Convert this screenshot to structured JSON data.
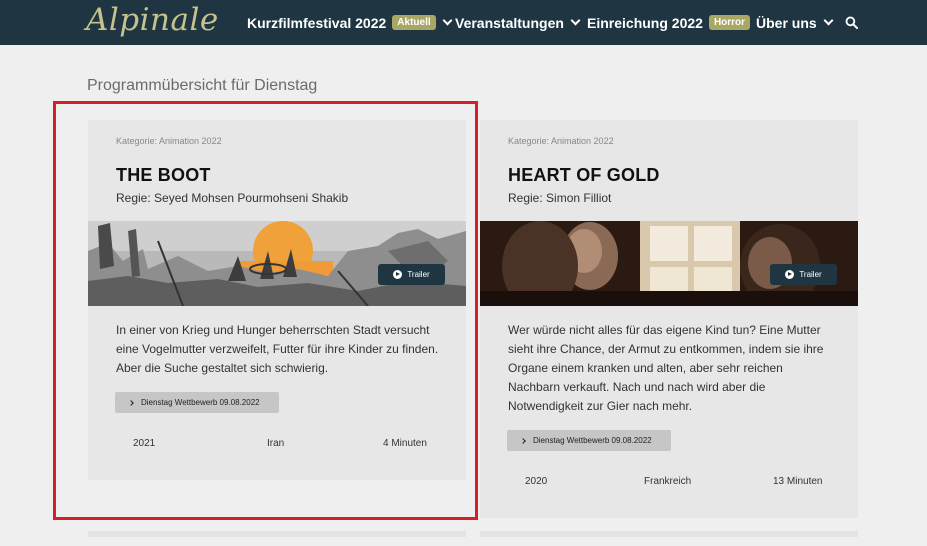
{
  "brand": {
    "logo_text": "Alpinale"
  },
  "nav": {
    "items": [
      {
        "label": "Kurzfilmfestival 2022",
        "badge": "Aktuell",
        "has_dropdown": true
      },
      {
        "label": "Veranstaltungen",
        "badge": "",
        "has_dropdown": true
      },
      {
        "label": "Einreichung 2022",
        "badge": "Horror",
        "has_dropdown": false
      },
      {
        "label": "Über uns",
        "badge": "",
        "has_dropdown": true
      }
    ],
    "search_icon": "search-icon"
  },
  "page": {
    "title": "Programmübersicht für Dienstag"
  },
  "cards": [
    {
      "category": "Kategorie: Animation 2022",
      "title": "THE BOOT",
      "director": "Regie: Seyed Mohsen Pourmohseni Shakib",
      "trailer_label": "Trailer",
      "description": "In einer von Krieg und Hunger beherrschten Stadt versucht eine Vogelmutter verzweifelt, Futter für ihre Kinder zu finden. Aber die Suche gestaltet sich schwierig.",
      "event_label": "Dienstag Wettbewerb 09.08.2022",
      "year": "2021",
      "country": "Iran",
      "duration": "4 Minuten",
      "highlighted": true
    },
    {
      "category": "Kategorie: Animation 2022",
      "title": "HEART OF GOLD",
      "director": "Regie: Simon Filliot",
      "trailer_label": "Trailer",
      "description": "Wer würde nicht alles für das eigene Kind tun? Eine Mutter sieht ihre Chance, der Armut zu entkommen, indem sie ihre Organe einem kranken und alten, aber sehr reichen Nachbarn verkauft. Nach und nach wird aber die Notwendigkeit zur Gier nach mehr.",
      "event_label": "Dienstag Wettbewerb 09.08.2022",
      "year": "2020",
      "country": "Frankreich",
      "duration": "13 Minuten",
      "highlighted": false
    }
  ],
  "colors": {
    "navbar": "#1f3642",
    "badge": "#a8a764",
    "highlight": "#d61f26",
    "card": "#e7e7e7"
  }
}
